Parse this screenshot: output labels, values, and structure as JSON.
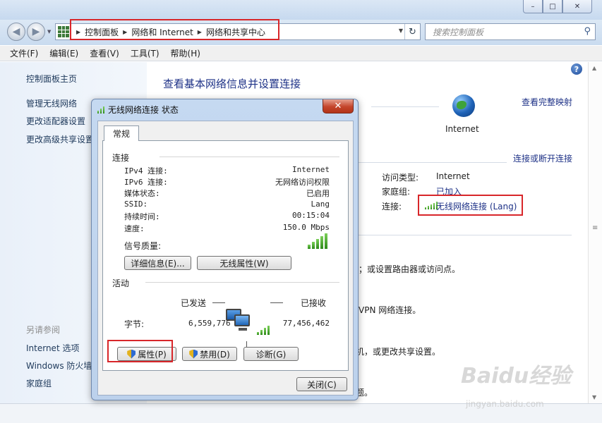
{
  "window": {
    "min": "–",
    "max": "□",
    "close": "✕"
  },
  "breadcrumb": [
    "控制面板",
    "网络和 Internet",
    "网络和共享中心"
  ],
  "search": {
    "placeholder": "搜索控制面板"
  },
  "menu": [
    "文件(F)",
    "编辑(E)",
    "查看(V)",
    "工具(T)",
    "帮助(H)"
  ],
  "sidebar": {
    "items": [
      "控制面板主页",
      "管理无线网络",
      "更改适配器设置",
      "更改高级共享设置"
    ],
    "see_also_title": "另请参阅",
    "see_also": [
      "Internet 选项",
      "Windows 防火墙",
      "家庭组"
    ]
  },
  "main": {
    "title": "查看基本网络信息并设置连接",
    "view_full_map": "查看完整映射",
    "internet_label": "Internet",
    "connect_disconnect": "连接或断开连接",
    "access_type_label": "访问类型:",
    "access_type_value": "Internet",
    "homegroup_label": "家庭组:",
    "homegroup_value": "已加入",
    "connection_label": "连接:",
    "connection_value": "无线网络连接 (Lang)",
    "task1": "；或设置路由器或访问点。",
    "task2": "VPN 网络连接。",
    "task3": "机，或更改共享设置。",
    "task4": "题。"
  },
  "dialog": {
    "title": "无线网络连接 状态",
    "close": "✕",
    "tab": "常规",
    "group_connection": "连接",
    "rows": [
      {
        "label": "IPv4 连接:",
        "value": "Internet"
      },
      {
        "label": "IPv6 连接:",
        "value": "无网络访问权限"
      },
      {
        "label": "媒体状态:",
        "value": "已启用"
      },
      {
        "label": "SSID:",
        "value": "Lang"
      },
      {
        "label": "持续时间:",
        "value": "00:15:04"
      },
      {
        "label": "速度:",
        "value": "150.0 Mbps"
      }
    ],
    "signal_label": "信号质量:",
    "details_button": "详细信息(E)...",
    "wireless_props_button": "无线属性(W)",
    "group_activity": "活动",
    "sent_label": "已发送",
    "received_label": "已接收",
    "bytes_label": "字节:",
    "bytes_sent": "6,559,776",
    "bytes_received": "77,456,462",
    "properties_button": "属性(P)",
    "disable_button": "禁用(D)",
    "diagnose_button": "诊断(G)",
    "close_button": "关闭(C)"
  },
  "watermark": {
    "logo": "Baidu经验",
    "url": "jingyan.baidu.com"
  },
  "colors": {
    "highlight_red": "#d8262a",
    "link_blue": "#1e3287",
    "signal_green": "#2e8a1a"
  }
}
